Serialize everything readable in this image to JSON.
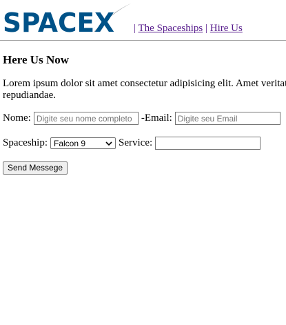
{
  "brand": {
    "logo_text": "SPACEX"
  },
  "nav": {
    "items": [
      "The Spaceships",
      "Hire Us"
    ],
    "separator": "|"
  },
  "page": {
    "heading": "Here Us Now",
    "paragraph": "Lorem ipsum dolor sit amet consectetur adipisicing elit. Amet veritatis repudiandae."
  },
  "form": {
    "nome_label": "Nome:",
    "nome_placeholder": "Digite seu nome completo",
    "email_label": "-Email:",
    "email_placeholder": "Digite seu Email",
    "spaceship_label": "Spaceship:",
    "spaceship_selected": "Falcon 9",
    "service_label": "Service:",
    "service_value": "",
    "submit_label": "Send Messege"
  },
  "colors": {
    "logo_blue": "#005288",
    "link": "#551a8b",
    "swoosh": "#a7a9ac"
  },
  "icons": {
    "select_arrow": "chevron-down-icon"
  }
}
